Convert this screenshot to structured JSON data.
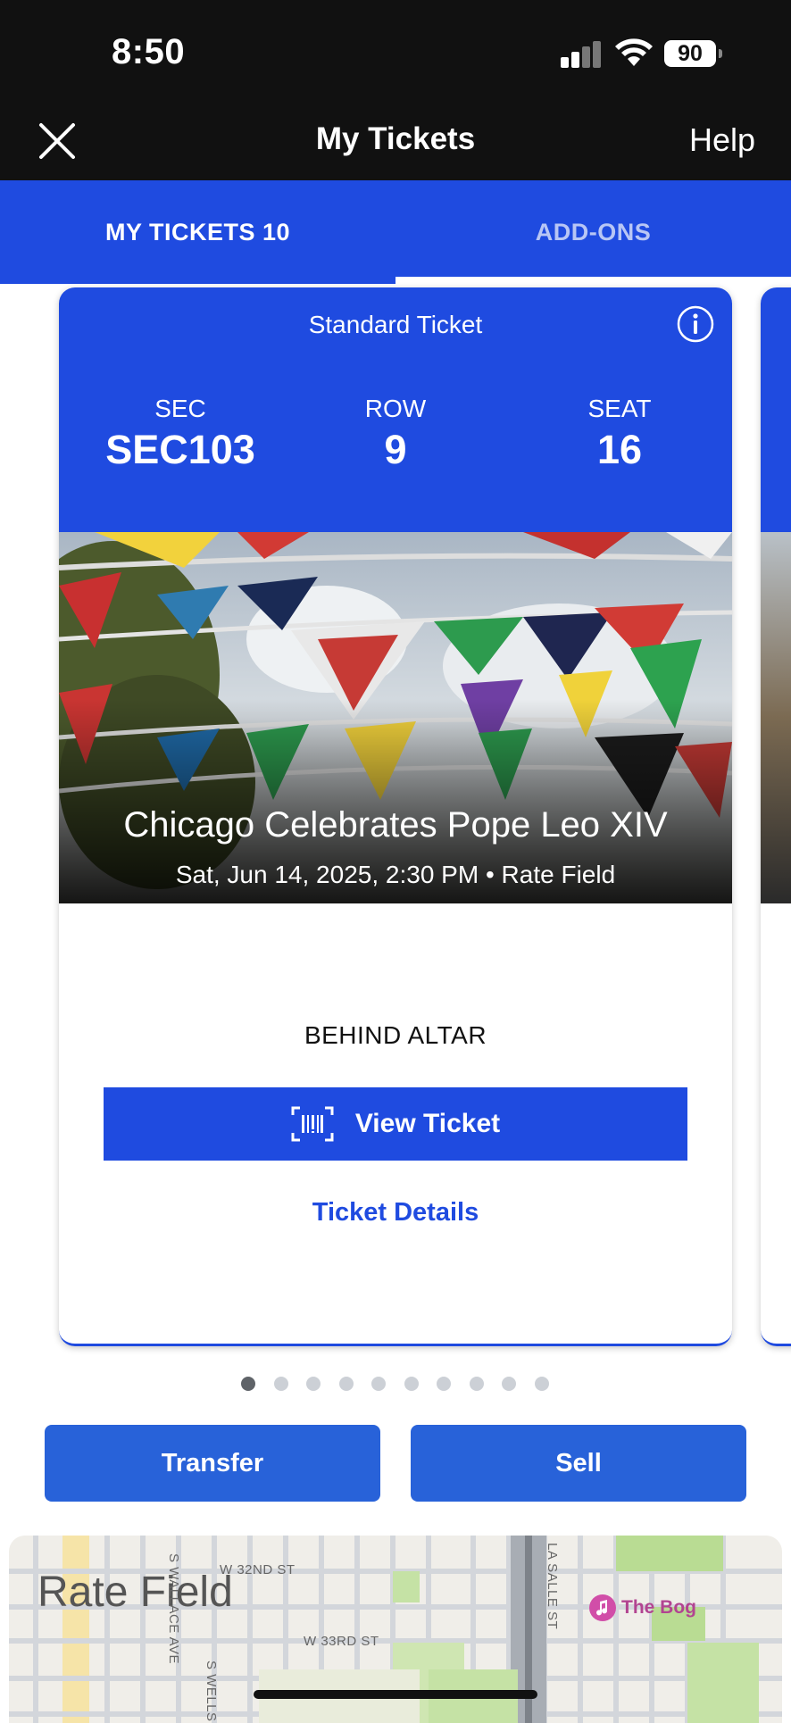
{
  "status_bar": {
    "time": "8:50",
    "battery": "90"
  },
  "nav": {
    "title": "My Tickets",
    "help": "Help"
  },
  "tabs": {
    "my_tickets": "MY TICKETS 10",
    "add_ons": "ADD-ONS"
  },
  "ticket": {
    "type": "Standard Ticket",
    "sec_label": "SEC",
    "sec_value": "SEC103",
    "row_label": "ROW",
    "row_value": "9",
    "seat_label": "SEAT",
    "seat_value": "16",
    "event_title": "Chicago Celebrates Pope Leo XIV",
    "event_subtitle": "Sat, Jun 14, 2025, 2:30 PM • Rate Field",
    "section_note": "BEHIND ALTAR",
    "view_button": "View Ticket",
    "details_link": "Ticket Details"
  },
  "pager": {
    "total": 10,
    "active_index": 0
  },
  "actions": {
    "transfer": "Transfer",
    "sell": "Sell"
  },
  "map": {
    "title": "Rate Field",
    "poi": "The Bog",
    "streets": [
      "W 32ND ST",
      "W 33RD ST",
      "LA SALLE ST",
      "S WELLS",
      "S WALLACE AVE"
    ]
  },
  "colors": {
    "primary_blue": "#1f4be0",
    "button_blue": "#2862d9",
    "header_black": "#111111"
  }
}
